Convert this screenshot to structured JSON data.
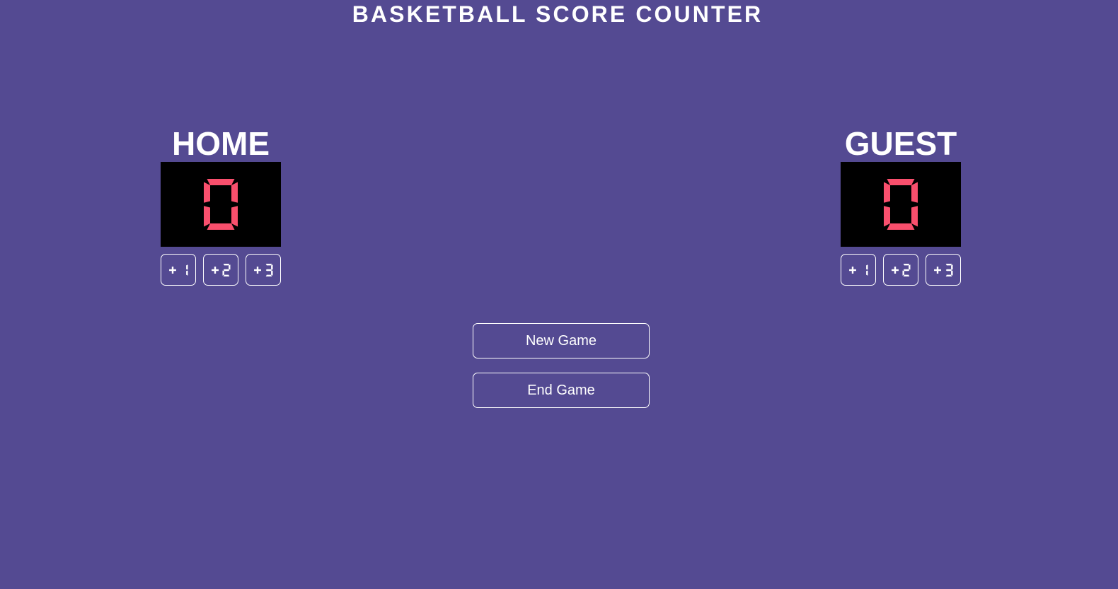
{
  "app": {
    "title": "BASKETBALL SCORE COUNTER"
  },
  "colors": {
    "background": "#544a92",
    "score_panel": "#000000",
    "score_digit": "#f94f6d",
    "text": "#ffffff"
  },
  "home": {
    "name": "HOME",
    "score": "0",
    "buttons": [
      "+1",
      "+2",
      "+3"
    ]
  },
  "guest": {
    "name": "GUEST",
    "score": "0",
    "buttons": [
      "+1",
      "+2",
      "+3"
    ]
  },
  "controls": {
    "new_game_label": "New Game",
    "end_game_label": "End Game"
  }
}
